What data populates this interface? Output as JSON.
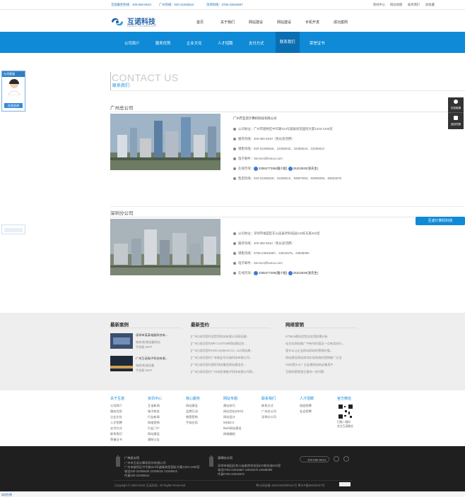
{
  "topbar": {
    "hotline_national": "全国服务热线：400-660-5510",
    "hotline_guangzhou": "广州热线：020-22265510",
    "hotline_shenzhen": "深圳热线：0755-23915687",
    "links": [
      "新闻中心",
      "网站地图",
      "联系我们",
      "加收藏"
    ]
  },
  "logo": {
    "name": "互诺科技",
    "tagline": "HUNUO TECHNOLOGY"
  },
  "mainnav": [
    "首页",
    "关于我们",
    "网站建设",
    "网站建设",
    "手机开发",
    "成功案例"
  ],
  "subnav": {
    "items": [
      "公司简介",
      "服务优势",
      "企业文化",
      "人才招聘",
      "支付方式",
      "联系我们",
      "荣誉证书"
    ],
    "active_index": 5
  },
  "page_title": {
    "en": "CONTACT US",
    "cn": "联系我们"
  },
  "guangzhou": {
    "title": "广州总公司",
    "company": "广州市互诺计算机科技有限公司",
    "address": "公司地址：广州市越秀区中华路313号越泰商贸国际大厦1203-1205室",
    "service": "服务热线：400 660 5510（免长途话费）",
    "sales": "销售热线：020-22265530、22265032、22265510、22265512",
    "email": "电子邮件：Service@hunuo.com",
    "online_label": "在线咨询：",
    "qq1": "2355277355(雅小姐)",
    "qq2": "25222820(张先生)",
    "fax": "售后热线：020-22265530、22265512、83807083、83809266、83833578"
  },
  "shenzhen": {
    "title": "深圳分公司",
    "address": "公司地址：深圳市福田区车公庙泰然科技园210栋东座403室",
    "service": "服务热线：400 660 5510（免长途话费）",
    "sales": "销售热线：0755-23915687、23915675、23938090",
    "email": "电子邮件：Service@hunuo.com",
    "online_label": "在线咨询：",
    "qq1": "2355277355(雅小姐)",
    "qq2": "25222820(张先生)"
  },
  "footer_cols": {
    "cases_title": "最新案例",
    "cases": [
      {
        "title": "深圳市某某电器科技有...",
        "l1": "电机/机械设备网站",
        "l2": "手机版 WAP"
      },
      {
        "title": "广州互诺电子科技有限...",
        "l1": "电机/机械设备",
        "l2": "手机版 WAP"
      }
    ],
    "signed_title": "最新签约",
    "signed": [
      "[广州]   成功签约佰世恒科技有限公司网站建...",
      "[广州]   成功签约MR CUSTOM网站建设合...",
      "[广州]   成功签约Herb Systems Co., Ltd.网站建...",
      "[广州]   成功签约广东新业华光电科技有限公司...",
      "[广州]   成功签约国旺科技集团网站建设合...",
      "[广州]   成功签约广州市凯瑞电子科技有限公司网..."
    ],
    "marketing_title": "网络营销",
    "marketing": [
      "HTML5建站优势及应用前景分析",
      "论文在网站推广中有何价值及一点有用技巧...",
      "是什么让企业网站网站的营销价值...",
      "网站建设网站如何实现高效的营销推广方法",
      "CDD是什么？企业建网站的必备用户",
      "互联网营销里注意的一些问题"
    ]
  },
  "links": [
    {
      "title": "关于互诺",
      "items": [
        "公司简介",
        "服务优势",
        "企业文化",
        "人才招聘",
        "支付方式",
        "联系我们",
        "荣誉证书"
      ]
    },
    {
      "title": "资讯中心",
      "items": [
        "互诺新闻",
        "电子商务",
        "行业新闻",
        "网络营销",
        "行业门户",
        "网站建设",
        "通知公告"
      ]
    },
    {
      "title": "核心服务",
      "items": [
        "网站建设",
        "品牌互动",
        "微营营销",
        "手机应用"
      ]
    },
    {
      "title": "网站专题",
      "items": [
        "建站技巧",
        "网站优化(SEO)",
        "网站设计",
        "WEB2.0",
        "flash网站建设",
        "网络编程"
      ]
    },
    {
      "title": "联系我们",
      "items": [
        "联系方式",
        "广州总公司",
        "深圳分公司"
      ]
    },
    {
      "title": "人才招聘",
      "items": [
        "校园招聘",
        "社会招聘"
      ]
    },
    {
      "title": "官方微信",
      "items": [
        "扫描二维码",
        "关注互诺微信"
      ]
    }
  ],
  "darkfoot": {
    "gz_title": "广州总公司",
    "gz_l1": "广州市互诺计算机科技有限公司",
    "gz_l2": "广州市越秀区中华路313号越泰商贸国际大厦1203-1205室",
    "gz_l3": "电话020-22265530 22265032 22265510",
    "gz_l4": "传真020-22265512",
    "sz_title": "深圳分公司",
    "sz_l1": "深圳市福田区车公庙泰然科技园210栋东座403室",
    "sz_l2": "电话0755-23915687 23915675 23938090",
    "sz_l3": "传真0755-23915679",
    "phone": "400-660-5510",
    "copyright": "Copyright © 2003-2016 互诺科技. All Rights Reserved",
    "icp": "粤公网安备 44010402000111号  粤ICP备09109237号"
  },
  "side": {
    "left_label": "在线客服",
    "left_btn": "在线咨询",
    "right_top": "在线客服",
    "right_bottom": "返回顶部",
    "float_btn": "互诺计算机科技"
  },
  "bottom_bar": "QQ在线"
}
